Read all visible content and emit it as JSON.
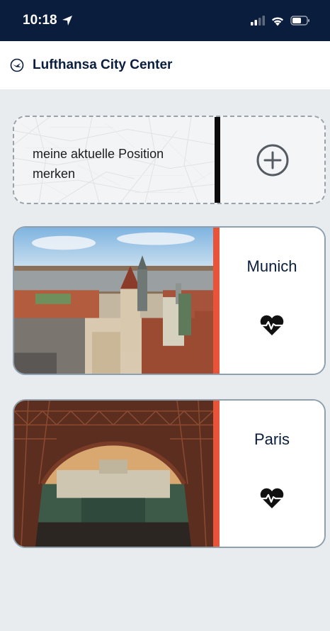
{
  "status": {
    "time": "10:18",
    "icons": [
      "location-arrow-icon",
      "signal-icon",
      "wifi-icon",
      "battery-icon"
    ]
  },
  "header": {
    "logo": "lufthansa-crane-icon",
    "title": "Lufthansa City Center"
  },
  "add_location": {
    "label": "meine aktuelle Position merken",
    "icon": "add-circle-icon"
  },
  "cities": [
    {
      "name": "Munich",
      "favorite_icon": "heart-pulse-icon"
    },
    {
      "name": "Paris",
      "favorite_icon": "heart-pulse-icon"
    }
  ],
  "colors": {
    "status_bar": "#0a1d3d",
    "brand_text": "#0a1d3d",
    "accent": "#e8533a",
    "background": "#e8ecef",
    "card_border": "#8ea0ae"
  }
}
